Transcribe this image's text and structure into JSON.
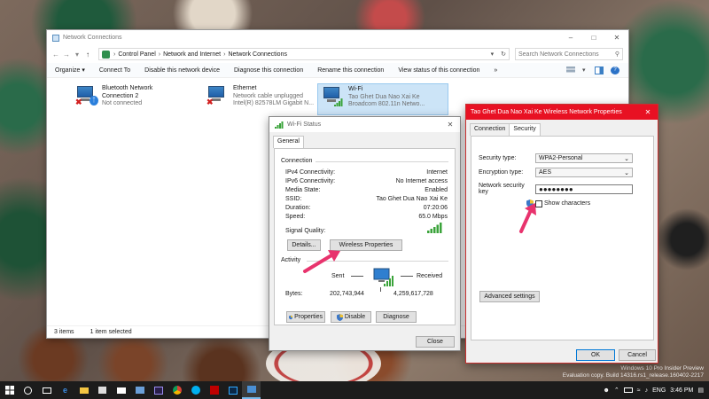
{
  "network_connections": {
    "title": "Network Connections",
    "breadcrumb": [
      "Control Panel",
      "Network and Internet",
      "Network Connections"
    ],
    "search_placeholder": "Search Network Connections",
    "commands": [
      "Organize ▾",
      "Connect To",
      "Disable this network device",
      "Diagnose this connection",
      "Rename this connection",
      "View status of this connection",
      "»"
    ],
    "adapters": [
      {
        "name": "Bluetooth Network",
        "line2": "Connection 2",
        "line3": "Not connected"
      },
      {
        "name": "Ethernet",
        "line2": "Network cable unplugged",
        "line3": "Intel(R) 82578LM Gigabit N..."
      },
      {
        "name": "Wi-Fi",
        "line2": "Tao Ghet Dua Nao Xai Ke",
        "line3": "Broadcom 802.11n Netwo..."
      }
    ],
    "status_items": "3 items",
    "status_selected": "1 item selected"
  },
  "wifi_status": {
    "title": "Wi-Fi Status",
    "tab": "General",
    "connection_label": "Connection",
    "rows": [
      {
        "label": "IPv4 Connectivity:",
        "value": "Internet"
      },
      {
        "label": "IPv6 Connectivity:",
        "value": "No Internet access"
      },
      {
        "label": "Media State:",
        "value": "Enabled"
      },
      {
        "label": "SSID:",
        "value": "Tao Ghet Dua Nao Xai Ke"
      },
      {
        "label": "Duration:",
        "value": "07:20:06"
      },
      {
        "label": "Speed:",
        "value": "65.0 Mbps"
      }
    ],
    "signal_label": "Signal Quality:",
    "details_btn": "Details...",
    "wireless_props_btn": "Wireless Properties",
    "activity_label": "Activity",
    "sent_label": "Sent",
    "received_label": "Received",
    "bytes_label": "Bytes:",
    "bytes_sent": "202,743,944",
    "bytes_received": "4,259,617,728",
    "properties_btn": "Properties",
    "disable_btn": "Disable",
    "diagnose_btn": "Diagnose",
    "close_btn": "Close"
  },
  "properties": {
    "title": "Tao Ghet Dua Nao Xai Ke Wireless Network Properties",
    "tabs": [
      "Connection",
      "Security"
    ],
    "security_type_label": "Security type:",
    "security_type_value": "WPA2-Personal",
    "encryption_label": "Encryption type:",
    "encryption_value": "AES",
    "key_label": "Network security key",
    "key_value": "●●●●●●●●",
    "show_chars": "Show characters",
    "advanced_btn": "Advanced settings",
    "ok_btn": "OK",
    "cancel_btn": "Cancel"
  },
  "watermark": {
    "line1": "Windows 10 Pro Insider Preview",
    "line2": "Evaluation copy. Build 14316.rs1_release.160402-2217"
  },
  "taskbar": {
    "lang": "ENG",
    "time": "3:46 PM"
  },
  "colors": {
    "accent_red": "#e81123",
    "arrow_pink": "#e8336d",
    "signal_green": "#3aa33a"
  }
}
